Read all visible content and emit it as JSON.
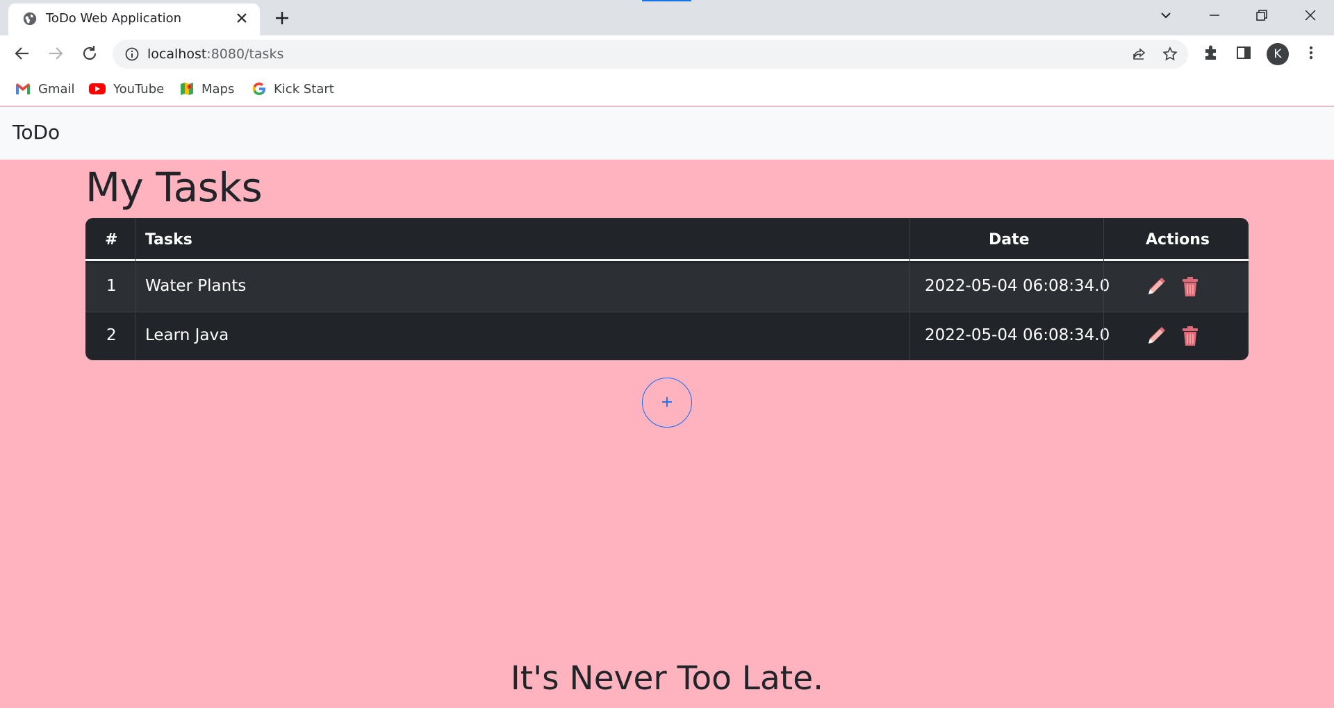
{
  "browser": {
    "tab_title": "ToDo Web Application",
    "url_host": "localhost",
    "url_path": ":8080/tasks",
    "profile_initial": "K",
    "bookmarks": [
      {
        "label": "Gmail",
        "icon": "gmail-icon"
      },
      {
        "label": "YouTube",
        "icon": "youtube-icon"
      },
      {
        "label": "Maps",
        "icon": "maps-icon"
      },
      {
        "label": "Kick Start",
        "icon": "google-icon"
      }
    ]
  },
  "navbar": {
    "brand": "ToDo"
  },
  "page": {
    "title": "My Tasks",
    "add_label": "+",
    "motto": "It's Never Too Late."
  },
  "table": {
    "headers": {
      "index": "#",
      "task": "Tasks",
      "date": "Date",
      "actions": "Actions"
    },
    "rows": [
      {
        "index": "1",
        "task": "Water Plants",
        "date": "2022-05-04 06:08:34.0"
      },
      {
        "index": "2",
        "task": "Learn Java",
        "date": "2022-05-04 06:08:34.0"
      }
    ]
  },
  "colors": {
    "page_background": "#ffb3be",
    "table_background": "#212529",
    "accent": "#0d6efd",
    "delete_icon": "#e0697a"
  }
}
